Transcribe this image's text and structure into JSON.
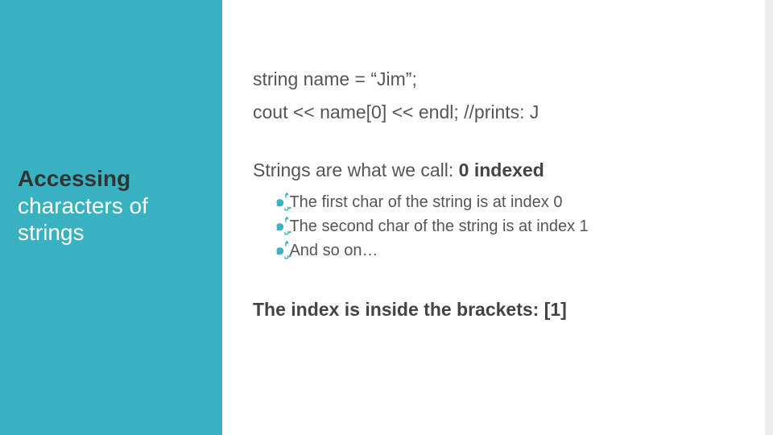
{
  "sidebar": {
    "title_bold": "Accessing",
    "title_rest_line2": "characters of",
    "title_rest_line3": "strings"
  },
  "content": {
    "code1": "string name = “Jim”;",
    "code2": "cout << name[0] << endl; //prints: J",
    "heading_pre": "Strings are what we call: ",
    "heading_bold": "0 indexed",
    "bullets": {
      "b1": "The first char of the string is at index 0",
      "b2": "The second char of the string is at index 1",
      "b3": "And so on…"
    },
    "closing": "The index is inside the brackets: [1]"
  },
  "bullet_glyph": "๑ۣۢ"
}
